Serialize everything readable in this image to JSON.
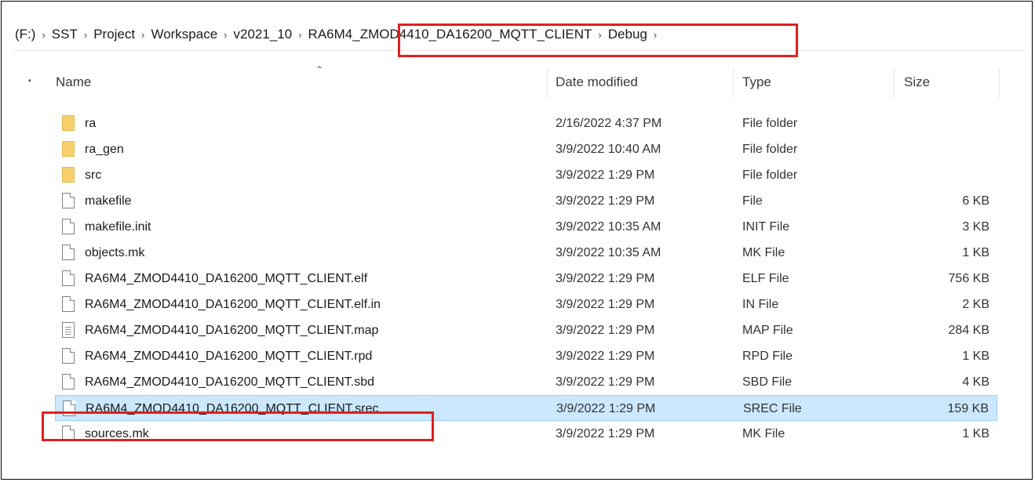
{
  "breadcrumb": [
    "(F:)",
    "SST",
    "Project",
    "Workspace",
    "v2021_10",
    "RA6M4_ZMOD4410_DA16200_MQTT_CLIENT",
    "Debug"
  ],
  "columns": {
    "name": "Name",
    "date": "Date modified",
    "type": "Type",
    "size": "Size"
  },
  "files": [
    {
      "name": "ra",
      "date": "2/16/2022 4:37 PM",
      "type": "File folder",
      "size": "",
      "icon": "folder-icon"
    },
    {
      "name": "ra_gen",
      "date": "3/9/2022 10:40 AM",
      "type": "File folder",
      "size": "",
      "icon": "folder-icon"
    },
    {
      "name": "src",
      "date": "3/9/2022 1:29 PM",
      "type": "File folder",
      "size": "",
      "icon": "folder-icon"
    },
    {
      "name": "makefile",
      "date": "3/9/2022 1:29 PM",
      "type": "File",
      "size": "6 KB",
      "icon": "file-icon"
    },
    {
      "name": "makefile.init",
      "date": "3/9/2022 10:35 AM",
      "type": "INIT File",
      "size": "3 KB",
      "icon": "file-icon"
    },
    {
      "name": "objects.mk",
      "date": "3/9/2022 10:35 AM",
      "type": "MK File",
      "size": "1 KB",
      "icon": "file-icon"
    },
    {
      "name": "RA6M4_ZMOD4410_DA16200_MQTT_CLIENT.elf",
      "date": "3/9/2022 1:29 PM",
      "type": "ELF File",
      "size": "756 KB",
      "icon": "file-icon"
    },
    {
      "name": "RA6M4_ZMOD4410_DA16200_MQTT_CLIENT.elf.in",
      "date": "3/9/2022 1:29 PM",
      "type": "IN File",
      "size": "2 KB",
      "icon": "file-icon"
    },
    {
      "name": "RA6M4_ZMOD4410_DA16200_MQTT_CLIENT.map",
      "date": "3/9/2022 1:29 PM",
      "type": "MAP File",
      "size": "284 KB",
      "icon": "text-file-icon"
    },
    {
      "name": "RA6M4_ZMOD4410_DA16200_MQTT_CLIENT.rpd",
      "date": "3/9/2022 1:29 PM",
      "type": "RPD File",
      "size": "1 KB",
      "icon": "file-icon"
    },
    {
      "name": "RA6M4_ZMOD4410_DA16200_MQTT_CLIENT.sbd",
      "date": "3/9/2022 1:29 PM",
      "type": "SBD File",
      "size": "4 KB",
      "icon": "file-icon"
    },
    {
      "name": "RA6M4_ZMOD4410_DA16200_MQTT_CLIENT.srec",
      "date": "3/9/2022 1:29 PM",
      "type": "SREC File",
      "size": "159 KB",
      "icon": "file-icon",
      "selected": true
    },
    {
      "name": "sources.mk",
      "date": "3/9/2022 1:29 PM",
      "type": "MK File",
      "size": "1 KB",
      "icon": "file-icon"
    }
  ],
  "colors": {
    "highlight": "#e02020",
    "selection": "#cce8ff",
    "folder": "#f8d16c"
  }
}
